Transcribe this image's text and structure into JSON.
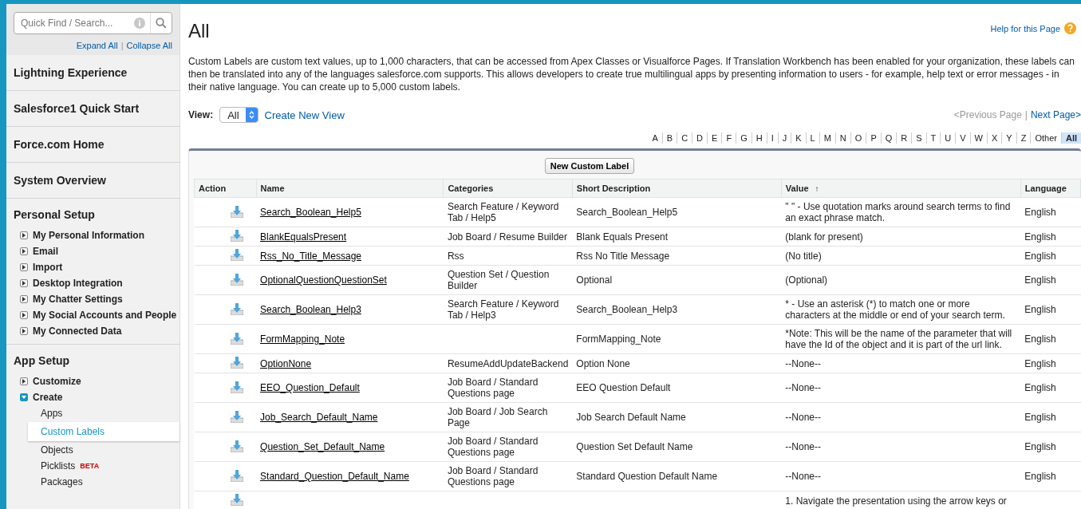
{
  "sidebar": {
    "search": {
      "placeholder": "Quick Find / Search..."
    },
    "links": [
      "Expand All",
      "Collapse All"
    ],
    "links_separator": "|",
    "headers": [
      "Lightning Experience",
      "Salesforce1 Quick Start",
      "Force.com Home",
      "System Overview"
    ],
    "sections": [
      {
        "title": "Personal Setup",
        "items": [
          {
            "label": "My Personal Information",
            "expanded": false
          },
          {
            "label": "Email",
            "expanded": false
          },
          {
            "label": "Import",
            "expanded": false
          },
          {
            "label": "Desktop Integration",
            "expanded": false
          },
          {
            "label": "My Chatter Settings",
            "expanded": false
          },
          {
            "label": "My Social Accounts and People",
            "expanded": false
          },
          {
            "label": "My Connected Data",
            "expanded": false
          }
        ]
      },
      {
        "title": "App Setup",
        "items": [
          {
            "label": "Customize",
            "expanded": false
          },
          {
            "label": "Create",
            "expanded": true,
            "children": [
              {
                "label": "Apps",
                "selected": false
              },
              {
                "label": "Custom Labels",
                "selected": true
              },
              {
                "label": "Objects",
                "selected": false
              },
              {
                "label": "Picklists",
                "selected": false,
                "badge": "BETA"
              },
              {
                "label": "Packages",
                "selected": false
              }
            ]
          }
        ]
      }
    ]
  },
  "page": {
    "title": "All",
    "help_link": "Help for this Page",
    "description": "Custom Labels are custom text values, up to 1,000 characters, that can be accessed from Apex Classes or Visualforce Pages. If Translation Workbench has been enabled for your organization, these labels can then be translated into any of the languages salesforce.com supports. This allows developers to create true multilingual apps by presenting information to users - for example, help text or error messages - in their native language. You can create up to 5,000 custom labels.",
    "view": {
      "label": "View:",
      "value": "All",
      "create_link": "Create New View"
    },
    "pager": {
      "previous": {
        "label": "<Previous Page",
        "disabled": true
      },
      "separator": "|",
      "next": {
        "label": "Next Page>",
        "disabled": false
      }
    },
    "letters": [
      {
        "label": "A",
        "selected": false
      },
      {
        "label": "B",
        "selected": false
      },
      {
        "label": "C",
        "selected": false
      },
      {
        "label": "D",
        "selected": false
      },
      {
        "label": "E",
        "selected": false
      },
      {
        "label": "F",
        "selected": false
      },
      {
        "label": "G",
        "selected": false
      },
      {
        "label": "H",
        "selected": false
      },
      {
        "label": "I",
        "selected": false
      },
      {
        "label": "J",
        "selected": false
      },
      {
        "label": "K",
        "selected": false
      },
      {
        "label": "L",
        "selected": false
      },
      {
        "label": "M",
        "selected": false
      },
      {
        "label": "N",
        "selected": false
      },
      {
        "label": "O",
        "selected": false
      },
      {
        "label": "P",
        "selected": false
      },
      {
        "label": "Q",
        "selected": false
      },
      {
        "label": "R",
        "selected": false
      },
      {
        "label": "S",
        "selected": false
      },
      {
        "label": "T",
        "selected": false
      },
      {
        "label": "U",
        "selected": false
      },
      {
        "label": "V",
        "selected": false
      },
      {
        "label": "W",
        "selected": false
      },
      {
        "label": "X",
        "selected": false
      },
      {
        "label": "Y",
        "selected": false
      },
      {
        "label": "Z",
        "selected": false
      },
      {
        "label": "Other",
        "selected": false
      },
      {
        "label": "All",
        "selected": true
      }
    ]
  },
  "table": {
    "button": "New Custom Label",
    "columns": [
      {
        "label": "Action"
      },
      {
        "label": "Name"
      },
      {
        "label": "Categories"
      },
      {
        "label": "Short Description"
      },
      {
        "label": "Value",
        "sort_mark": "↑"
      },
      {
        "label": "Language"
      }
    ],
    "rows": [
      {
        "name": "Search_Boolean_Help5",
        "categories": "Search Feature / Keyword Tab / Help5",
        "short_description": "Search_Boolean_Help5",
        "value": "\" \" - Use quotation marks around search terms to find an exact phrase match.",
        "language": "English"
      },
      {
        "name": "BlankEqualsPresent",
        "categories": "Job Board / Resume Builder",
        "short_description": "Blank Equals Present",
        "value": "(blank for present)",
        "language": "English"
      },
      {
        "name": "Rss_No_Title_Message",
        "categories": "Rss",
        "short_description": "Rss No Title Message",
        "value": "(No title)",
        "language": "English"
      },
      {
        "name": "OptionalQuestionQuestionSet",
        "categories": "Question Set / Question Builder",
        "short_description": "Optional",
        "value": "(Optional)",
        "language": "English"
      },
      {
        "name": "Search_Boolean_Help3",
        "categories": "Search Feature / Keyword Tab / Help3",
        "short_description": "Search_Boolean_Help3",
        "value": "* - Use an asterisk (*) to match one or more characters at the middle or end of your search term.",
        "language": "English"
      },
      {
        "name": "FormMapping_Note",
        "short_description": "FormMapping_Note",
        "value": "*Note: This will be the name of the parameter that will have the Id of the object and it is part of the url link.",
        "language": "English"
      },
      {
        "name": "OptionNone",
        "categories": "ResumeAddUpdateBackend",
        "short_description": "Option None",
        "value": "--None--",
        "language": "English"
      },
      {
        "name": "EEO_Question_Default",
        "categories": "Job Board / Standard Questions page",
        "short_description": "EEO Question Default",
        "value": "--None--",
        "language": "English"
      },
      {
        "name": "Job_Search_Default_Name",
        "categories": "Job Board / Job Search Page",
        "short_description": "Job Search Default Name",
        "value": "--None--",
        "language": "English"
      },
      {
        "name": "Question_Set_Default_Name",
        "categories": "Job Board / Standard Questions page",
        "short_description": "Question Set Default Name",
        "value": "--None--",
        "language": "English"
      },
      {
        "name": "Standard_Question_Default_Name",
        "categories": "Job Board / Standard Questions page",
        "short_description": "Standard Question Default Name",
        "value": "--None--",
        "language": "English"
      },
      {
        "value": "1. Navigate the presentation using the arrow keys or"
      }
    ]
  }
}
